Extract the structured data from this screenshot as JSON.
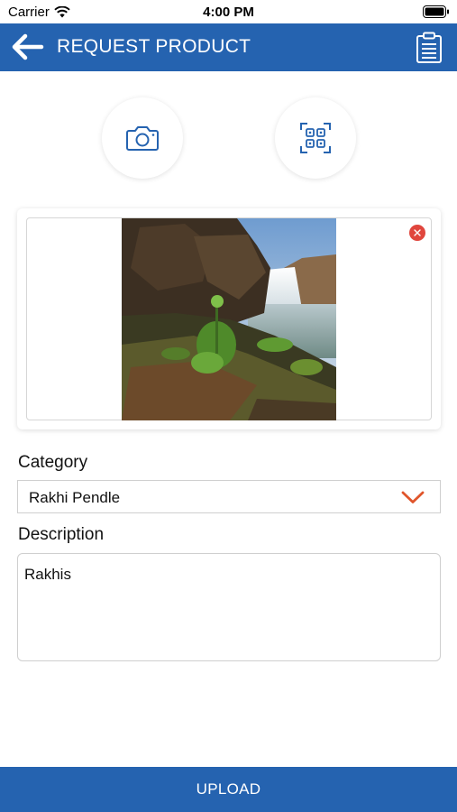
{
  "status_bar": {
    "carrier": "Carrier",
    "time": "4:00 PM"
  },
  "nav": {
    "title": "REQUEST PRODUCT",
    "back_icon": "arrow-left-icon",
    "clipboard_icon": "clipboard-icon"
  },
  "actions": {
    "camera_icon": "camera-icon",
    "scan_icon": "qr-scan-icon"
  },
  "image_card": {
    "remove_icon": "close-icon"
  },
  "form": {
    "category_label": "Category",
    "category_value": "Rakhi Pendle",
    "description_label": "Description",
    "description_value": "Rakhis"
  },
  "upload_label": "UPLOAD",
  "colors": {
    "primary": "#2563b0",
    "accent": "#e0552b",
    "danger": "#e0463d"
  }
}
